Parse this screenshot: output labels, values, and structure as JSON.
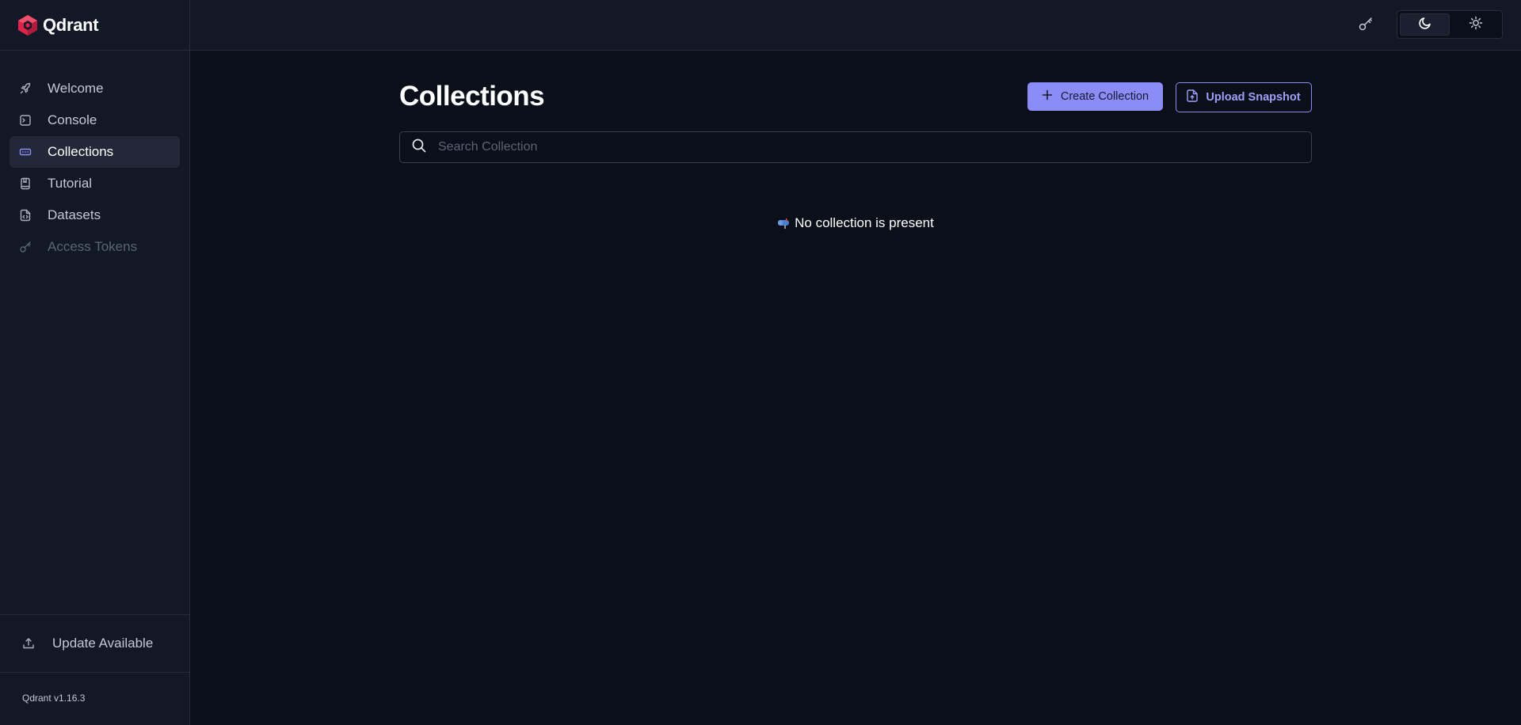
{
  "brand": {
    "name": "Qdrant",
    "accent": "#dc244c"
  },
  "sidebar": {
    "items": [
      {
        "label": "Welcome",
        "icon": "rocket-icon",
        "state": "normal"
      },
      {
        "label": "Console",
        "icon": "terminal-icon",
        "state": "normal"
      },
      {
        "label": "Collections",
        "icon": "collections-icon",
        "state": "active"
      },
      {
        "label": "Tutorial",
        "icon": "book-icon",
        "state": "normal"
      },
      {
        "label": "Datasets",
        "icon": "file-code-icon",
        "state": "normal"
      },
      {
        "label": "Access Tokens",
        "icon": "key-icon",
        "state": "disabled"
      }
    ],
    "update_label": "Update Available",
    "version": "Qdrant v1.16.3"
  },
  "topbar": {
    "api_key_icon": "key-icon",
    "theme": {
      "selected": "dark",
      "options": [
        "moon-icon",
        "sun-icon"
      ]
    }
  },
  "main": {
    "title": "Collections",
    "create_label": "Create Collection",
    "upload_label": "Upload Snapshot",
    "search_placeholder": "Search Collection",
    "empty_message": "No collection is present"
  },
  "colors": {
    "background": "#0b0f19",
    "sidebar": "#131826",
    "primary": "#8c8cf6"
  }
}
